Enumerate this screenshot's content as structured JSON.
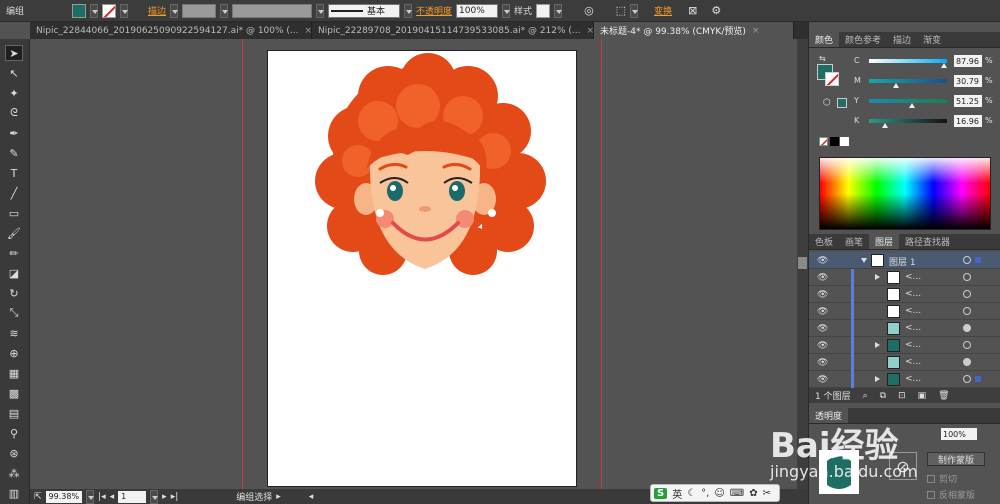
{
  "topbar": {
    "mode_label": "编组",
    "stroke_label": "描边",
    "stroke_style": "基本",
    "opacity_label": "不透明度",
    "opacity_value": "100%",
    "style_label": "样式",
    "transform_label": "变换"
  },
  "tabs": [
    {
      "label": "Nipic_22844066_20190625090922594127.ai* @ 100% (..."
    },
    {
      "label": "Nipic_22289708_20190415114739533085.ai* @ 212% (..."
    },
    {
      "label": "未标题-4* @ 99.38% (CMYK/预览)"
    }
  ],
  "statusbar": {
    "zoom": "99.38%",
    "page": "1",
    "status": "编组选择"
  },
  "color_panel": {
    "tabs": [
      "颜色",
      "颜色参考",
      "描边",
      "渐变"
    ],
    "channels": [
      {
        "name": "C",
        "value": "87.96"
      },
      {
        "name": "M",
        "value": "30.79"
      },
      {
        "name": "Y",
        "value": "51.25"
      },
      {
        "name": "K",
        "value": "16.96"
      }
    ],
    "fill_color": "#1e6e66"
  },
  "layers_panel": {
    "tabs": [
      "色板",
      "画笔",
      "图层",
      "路径查找器"
    ],
    "layer_name": "图层 1",
    "sublayer_label": "<...",
    "layer_count": "1 个图层"
  },
  "transparency_panel": {
    "tab": "透明度",
    "opacity_value": "100%",
    "make_mask": "制作蒙版",
    "clip": "剪切",
    "invert": "反相蒙版"
  },
  "ime": {
    "label": "英"
  },
  "watermark": {
    "brand": "Bai经验",
    "url": "jingyan.baidu.com"
  }
}
